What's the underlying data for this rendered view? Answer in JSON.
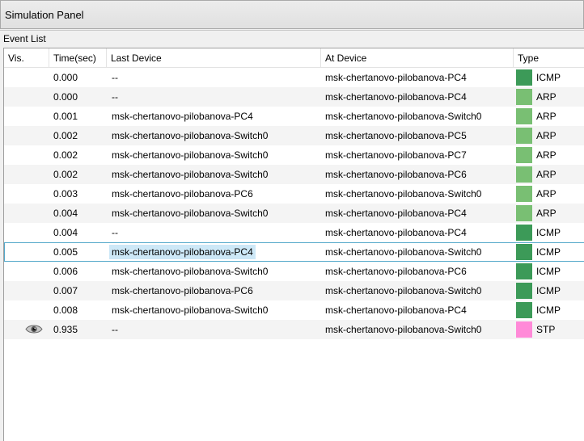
{
  "window": {
    "title": "Simulation Panel"
  },
  "group": {
    "label": "Event List"
  },
  "columns": {
    "vis": "Vis.",
    "time": "Time(sec)",
    "last": "Last Device",
    "at": "At Device",
    "type": "Type"
  },
  "colors": {
    "ICMP": "#3c9a58",
    "ARP": "#79bf73",
    "STP": "#ff8ad8",
    "selection": "#52a7c9"
  },
  "events": [
    {
      "vis": "",
      "time": "0.000",
      "last": "--",
      "at": "msk-chertanovo-pilobanova-PC4",
      "type": "ICMP"
    },
    {
      "vis": "",
      "time": "0.000",
      "last": "--",
      "at": "msk-chertanovo-pilobanova-PC4",
      "type": "ARP"
    },
    {
      "vis": "",
      "time": "0.001",
      "last": "msk-chertanovo-pilobanova-PC4",
      "at": "msk-chertanovo-pilobanova-Switch0",
      "type": "ARP"
    },
    {
      "vis": "",
      "time": "0.002",
      "last": "msk-chertanovo-pilobanova-Switch0",
      "at": "msk-chertanovo-pilobanova-PC5",
      "type": "ARP"
    },
    {
      "vis": "",
      "time": "0.002",
      "last": "msk-chertanovo-pilobanova-Switch0",
      "at": "msk-chertanovo-pilobanova-PC7",
      "type": "ARP"
    },
    {
      "vis": "",
      "time": "0.002",
      "last": "msk-chertanovo-pilobanova-Switch0",
      "at": "msk-chertanovo-pilobanova-PC6",
      "type": "ARP"
    },
    {
      "vis": "",
      "time": "0.003",
      "last": "msk-chertanovo-pilobanova-PC6",
      "at": "msk-chertanovo-pilobanova-Switch0",
      "type": "ARP"
    },
    {
      "vis": "",
      "time": "0.004",
      "last": "msk-chertanovo-pilobanova-Switch0",
      "at": "msk-chertanovo-pilobanova-PC4",
      "type": "ARP"
    },
    {
      "vis": "",
      "time": "0.004",
      "last": "--",
      "at": "msk-chertanovo-pilobanova-PC4",
      "type": "ICMP"
    },
    {
      "vis": "",
      "time": "0.005",
      "last": "msk-chertanovo-pilobanova-PC4",
      "at": "msk-chertanovo-pilobanova-Switch0",
      "type": "ICMP",
      "selected": true
    },
    {
      "vis": "",
      "time": "0.006",
      "last": "msk-chertanovo-pilobanova-Switch0",
      "at": "msk-chertanovo-pilobanova-PC6",
      "type": "ICMP"
    },
    {
      "vis": "",
      "time": "0.007",
      "last": "msk-chertanovo-pilobanova-PC6",
      "at": "msk-chertanovo-pilobanova-Switch0",
      "type": "ICMP"
    },
    {
      "vis": "",
      "time": "0.008",
      "last": "msk-chertanovo-pilobanova-Switch0",
      "at": "msk-chertanovo-pilobanova-PC4",
      "type": "ICMP"
    },
    {
      "vis": "eye-icon",
      "time": "0.935",
      "last": "--",
      "at": "msk-chertanovo-pilobanova-Switch0",
      "type": "STP"
    }
  ]
}
